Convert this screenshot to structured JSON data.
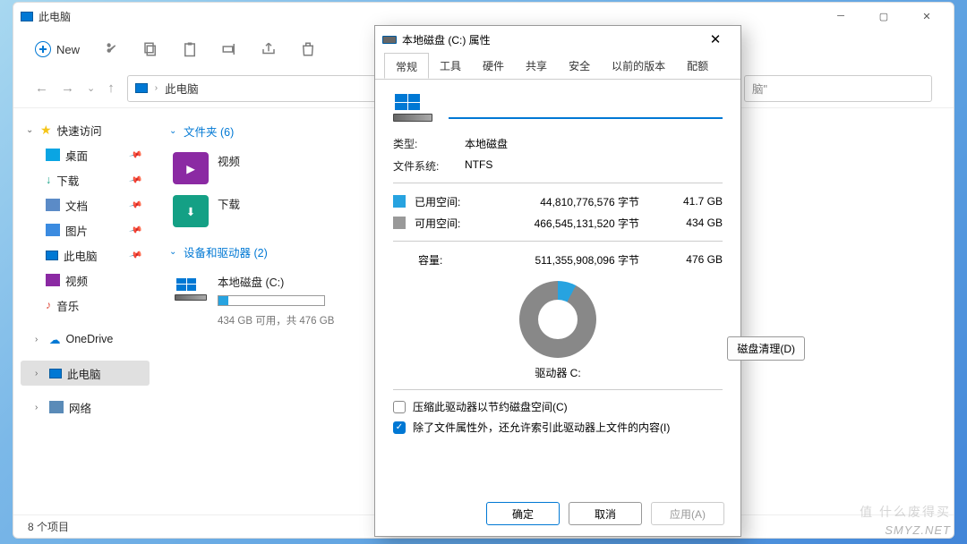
{
  "explorer": {
    "title": "此电脑",
    "new_btn": "New",
    "breadcrumb": {
      "root": "此电脑"
    },
    "search_placeholder": "脑\"",
    "sidebar": {
      "quick": "快速访问",
      "items": [
        {
          "label": "桌面"
        },
        {
          "label": "下载"
        },
        {
          "label": "文档"
        },
        {
          "label": "图片"
        },
        {
          "label": "此电脑"
        },
        {
          "label": "视频"
        },
        {
          "label": "音乐"
        }
      ],
      "onedrive": "OneDrive",
      "thispc": "此电脑",
      "network": "网络"
    },
    "sections": {
      "folders": {
        "title": "文件夹 (6)",
        "video": "视频",
        "downloads": "下载"
      },
      "devices": {
        "title": "设备和驱动器 (2)",
        "c_label": "本地磁盘 (C:)",
        "c_sub": "434 GB 可用，共 476 GB"
      }
    },
    "status": "8 个项目"
  },
  "dialog": {
    "title": "本地磁盘 (C:) 属性",
    "tabs": {
      "general": "常规",
      "tools": "工具",
      "hardware": "硬件",
      "sharing": "共享",
      "security": "安全",
      "previous": "以前的版本",
      "quota": "配额"
    },
    "type_label": "类型:",
    "type_value": "本地磁盘",
    "fs_label": "文件系统:",
    "fs_value": "NTFS",
    "used_label": "已用空间:",
    "used_bytes": "44,810,776,576 字节",
    "used_gb": "41.7 GB",
    "free_label": "可用空间:",
    "free_bytes": "466,545,131,520 字节",
    "free_gb": "434 GB",
    "cap_label": "容量:",
    "cap_bytes": "511,355,908,096 字节",
    "cap_gb": "476 GB",
    "drive_label": "驱动器 C:",
    "cleanup": "磁盘清理(D)",
    "compress": "压缩此驱动器以节约磁盘空间(C)",
    "index": "除了文件属性外，还允许索引此驱动器上文件的内容(I)",
    "ok": "确定",
    "cancel": "取消",
    "apply": "应用(A)"
  },
  "watermark": "SMYZ.NET",
  "watermark_cn": "值 什么废得买"
}
